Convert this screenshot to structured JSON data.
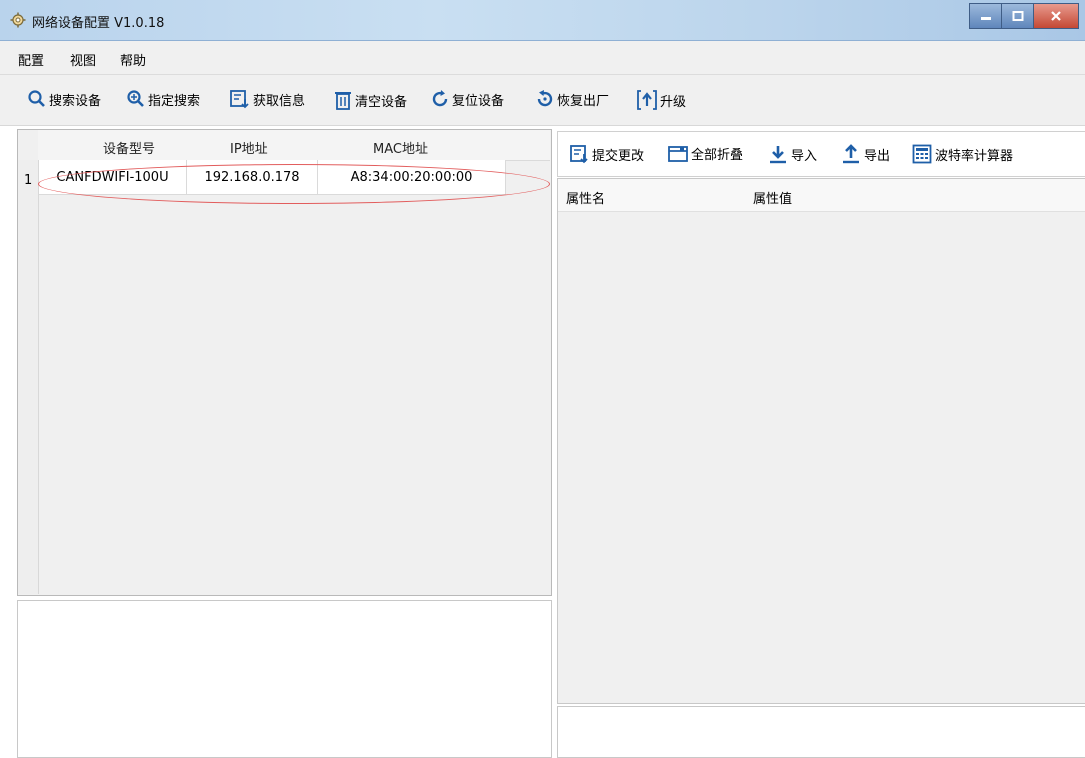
{
  "window": {
    "title": "网络设备配置 V1.0.18",
    "icon": "gear-icon"
  },
  "menu": [
    "配置",
    "视图",
    "帮助"
  ],
  "toolbar": {
    "search": "搜索设备",
    "targeted_search": "指定搜索",
    "get_info": "获取信息",
    "clear": "清空设备",
    "reset": "复位设备",
    "factory_reset": "恢复出厂",
    "upgrade": "升级"
  },
  "device_table": {
    "columns": [
      "设备型号",
      "IP地址",
      "MAC地址"
    ],
    "rows": [
      {
        "num": "1",
        "model": "CANFDWIFI-100U",
        "ip": "192.168.0.178",
        "mac": "A8:34:00:20:00:00"
      }
    ]
  },
  "property_toolbar": {
    "submit": "提交更改",
    "collapse_all": "全部折叠",
    "import": "导入",
    "export": "导出",
    "baud_calc": "波特率计算器"
  },
  "property_grid": {
    "columns": [
      "属性名",
      "属性值"
    ]
  },
  "colors": {
    "highlight": "#e25d5d",
    "icon_blue": "#1f5fa8"
  }
}
